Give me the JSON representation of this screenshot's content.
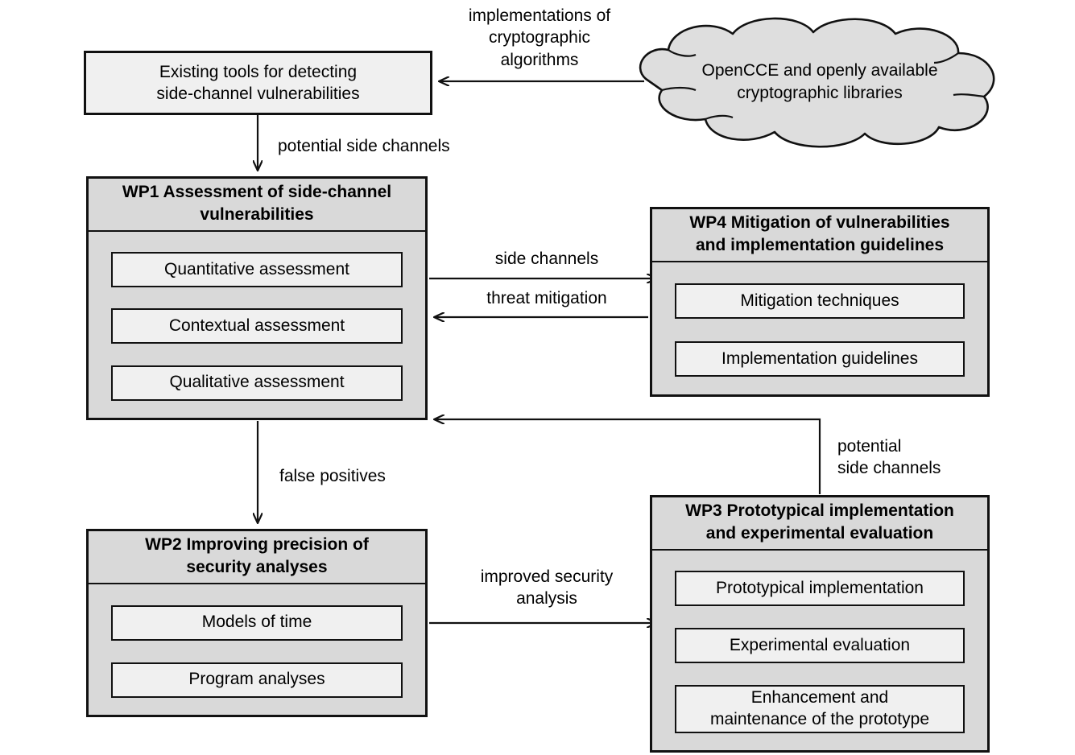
{
  "diagram": {
    "title": "Work package structure for side-channel vulnerability research",
    "colors": {
      "node_fill": "#d9d9d9",
      "subbox_fill": "#f0f0f0",
      "stroke": "#111111",
      "cloud_fill": "#dedede",
      "background": "#ffffff"
    }
  },
  "nodes": {
    "existing_tools": {
      "text": "Existing tools for detecting\nside-channel vulnerabilities"
    },
    "cloud": {
      "text": "OpenCCE and openly available\ncryptographic libraries",
      "icon": "cloud-shape"
    },
    "wp1": {
      "header": "WP1 Assessment of side-channel\nvulnerabilities",
      "items": [
        "Quantitative assessment",
        "Contextual assessment",
        "Qualitative assessment"
      ]
    },
    "wp4": {
      "header": "WP4 Mitigation of vulnerabilities\nand implementation guidelines",
      "items": [
        "Mitigation techniques",
        "Implementation guidelines"
      ]
    },
    "wp2": {
      "header": "WP2 Improving precision of\nsecurity analyses",
      "items": [
        "Models of time",
        "Program analyses"
      ]
    },
    "wp3": {
      "header": "WP3 Prototypical implementation\nand experimental evaluation",
      "items": [
        "Prototypical implementation",
        "Experimental evaluation",
        "Enhancement and\nmaintenance of the prototype"
      ]
    }
  },
  "edges": {
    "cloud_to_tools": "implementations of\ncryptographic\nalgorithms",
    "tools_to_wp1": "potential side channels",
    "wp1_to_wp4": "side channels",
    "wp4_to_wp1": "threat mitigation",
    "wp1_to_wp2": "false positives",
    "wp2_to_wp3": "improved security\nanalysis",
    "wp3_to_wp1": "potential\nside channels"
  }
}
